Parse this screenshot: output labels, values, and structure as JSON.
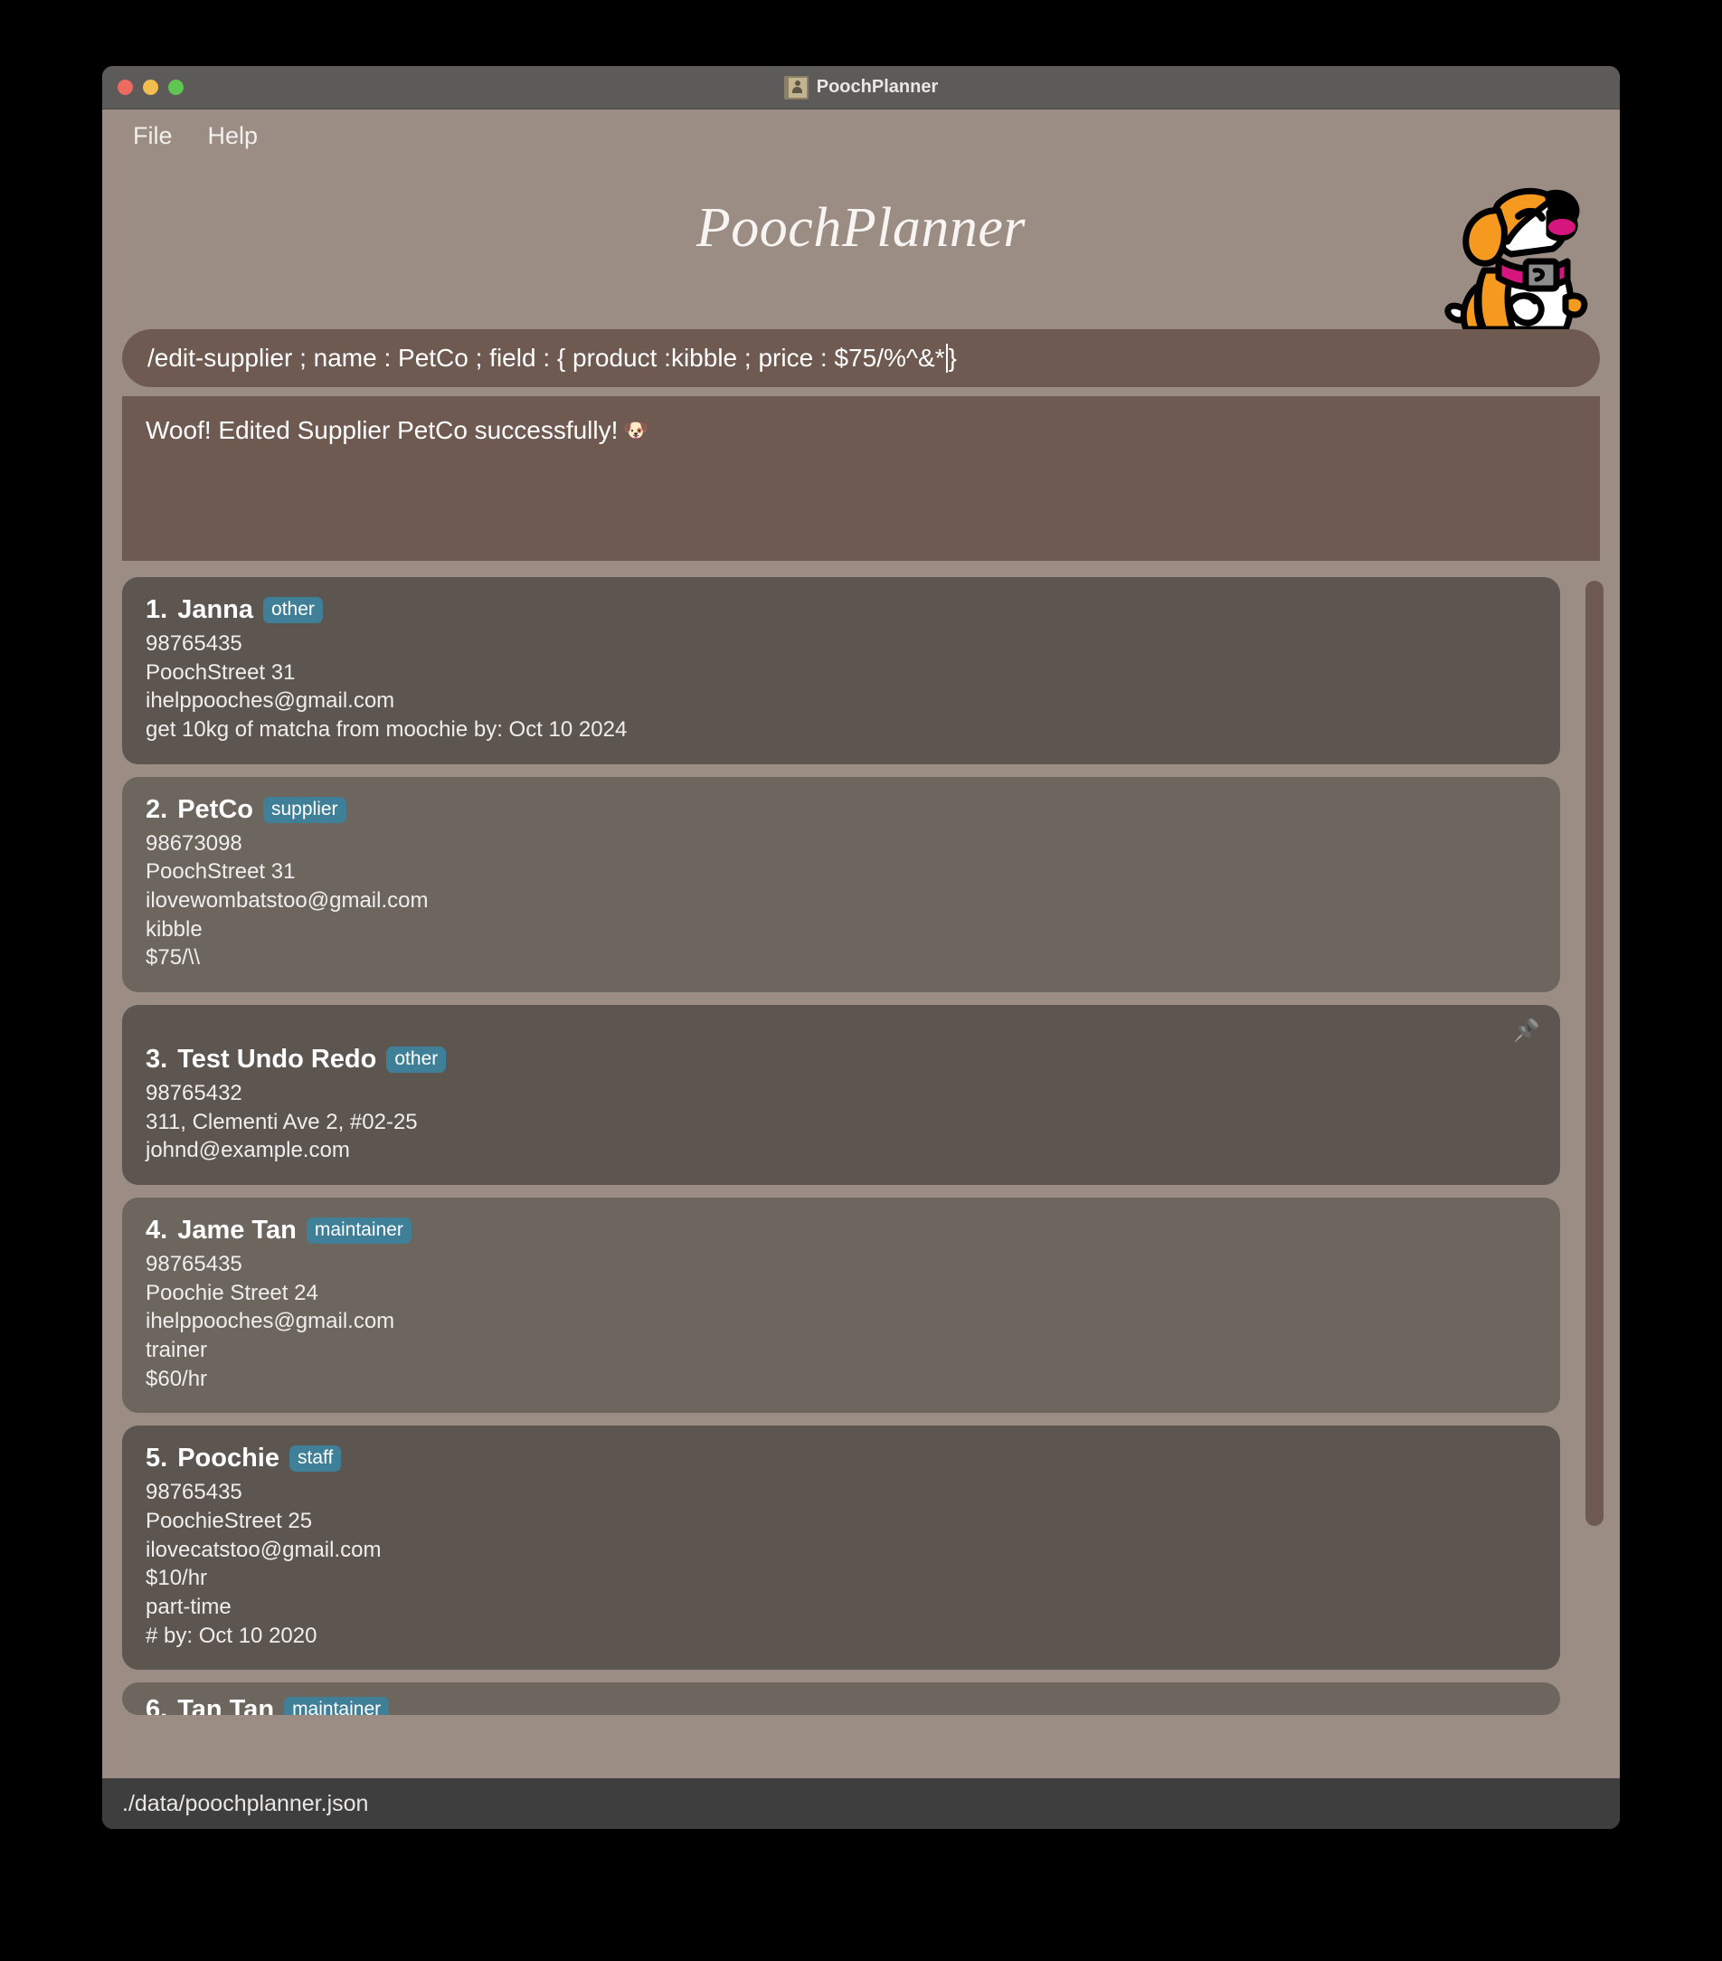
{
  "window": {
    "title": "PoochPlanner",
    "title_icon": "contact-book-icon",
    "traffic_lights": [
      "close",
      "minimize",
      "zoom"
    ]
  },
  "menubar": {
    "items": [
      {
        "label": "File"
      },
      {
        "label": "Help"
      }
    ]
  },
  "header": {
    "app_title": "PoochPlanner",
    "logo": "dog-mascot-logo"
  },
  "command": {
    "value": "/edit-supplier ; name : PetCo ; field : { product :kibble ; price : $75/%^&*",
    "value_after_caret": "}",
    "caret_visible": true
  },
  "result": {
    "message": "Woof! Edited Supplier PetCo successfully!",
    "emoji": "🐶"
  },
  "contacts": [
    {
      "index": "1.",
      "name": "Janna",
      "tag": "other",
      "pinned": false,
      "lines": [
        "98765435",
        "PoochStreet 31",
        "ihelppooches@gmail.com",
        "get 10kg of matcha from moochie by: Oct 10 2024"
      ]
    },
    {
      "index": "2.",
      "name": "PetCo",
      "tag": "supplier",
      "pinned": false,
      "lines": [
        "98673098",
        "PoochStreet 31",
        "ilovewombatstoo@gmail.com",
        "kibble",
        "$75/\\\\"
      ]
    },
    {
      "index": "3.",
      "name": "Test Undo Redo",
      "tag": "other",
      "pinned": true,
      "pin_icon": "📌",
      "lines": [
        "98765432",
        "311, Clementi Ave 2, #02-25",
        "johnd@example.com"
      ]
    },
    {
      "index": "4.",
      "name": "Jame Tan",
      "tag": "maintainer",
      "pinned": false,
      "lines": [
        "98765435",
        "Poochie Street 24",
        "ihelppooches@gmail.com",
        "trainer",
        "$60/hr"
      ]
    },
    {
      "index": "5.",
      "name": "Poochie",
      "tag": "staff",
      "pinned": false,
      "lines": [
        "98765435",
        "PoochieStreet 25",
        "ilovecatstoo@gmail.com",
        "$10/hr",
        "part-time",
        "# by: Oct 10 2020"
      ]
    },
    {
      "index": "6.",
      "name": "Tan Tan",
      "tag": "maintainer",
      "pinned": false,
      "clipped": true,
      "lines": []
    }
  ],
  "statusbar": {
    "path": "./data/poochplanner.json"
  },
  "colors": {
    "window_bg": "#9c8d84",
    "titlebar_bg": "#5d5b59",
    "command_bg": "#6e5a50",
    "card_dark": "#5c5550",
    "card_light": "#6d665f",
    "badge": "#3f7f98",
    "statusbar_bg": "#3e3e3e"
  }
}
